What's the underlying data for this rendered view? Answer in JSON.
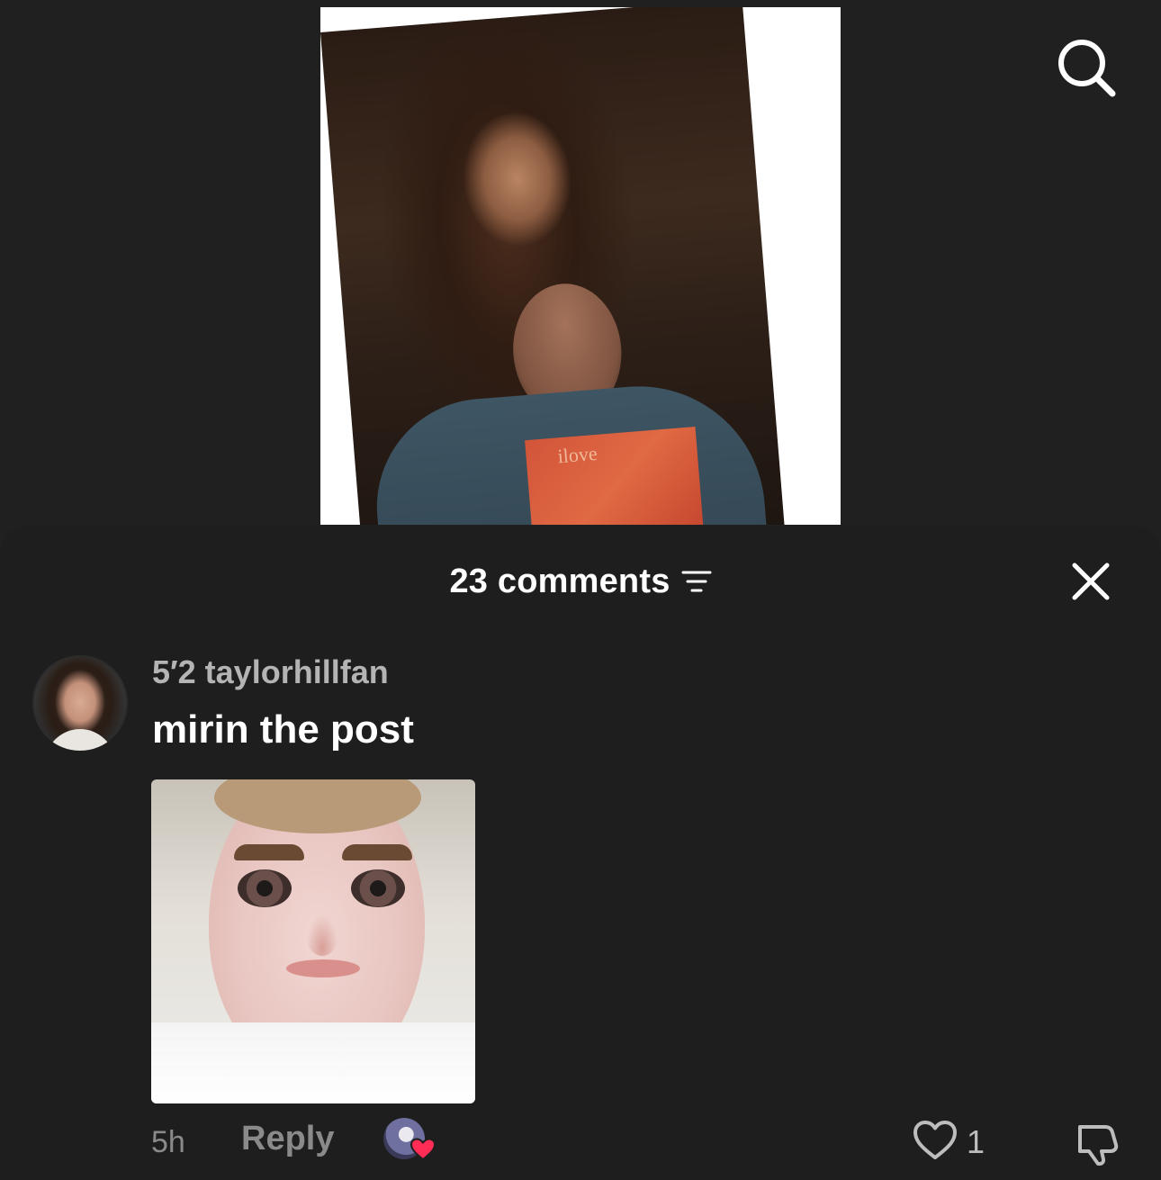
{
  "header": {
    "search_icon": "search-icon"
  },
  "comments_sheet": {
    "title": "23 comments",
    "sort_icon": "sort-icon",
    "close_icon": "close-icon"
  },
  "comment": {
    "username": "5′2 taylorhillfan",
    "text": "mirin the post",
    "timestamp": "5h",
    "reply_label": "Reply",
    "like_count": "1"
  },
  "post_image": {
    "shirt_text": "ilove"
  },
  "colors": {
    "background": "#202020",
    "sheet": "#1e1e1e",
    "heart_red": "#ff2d55",
    "muted_text": "#8a8a8a"
  }
}
